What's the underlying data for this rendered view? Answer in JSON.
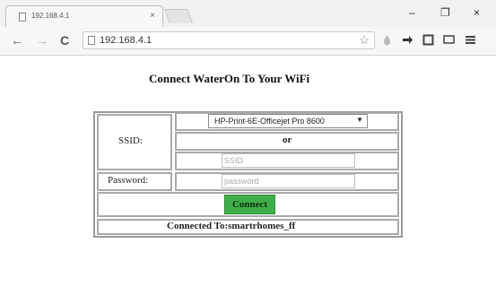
{
  "browser": {
    "tab_title": "192.168.4.1",
    "tab_close": "×",
    "url": "192.168.4.1",
    "window_controls": [
      "–",
      "❐",
      "×"
    ],
    "nav": {
      "back": "←",
      "forward": "→",
      "reload": "C"
    }
  },
  "page": {
    "heading": "Connect WaterOn To Your WiFi",
    "form": {
      "ssid_label": "SSID:",
      "ssid_selected": "HP-Print-6E-Officejet Pro 8600",
      "or_text": "or",
      "ssid_placeholder": "SSID",
      "password_label": "Password:",
      "password_placeholder": "password",
      "connect_label": "Connect",
      "status": "Connected To:smartrhomes_ff"
    }
  },
  "colors": {
    "connect_button": "#3fae49",
    "table_border": "#a9a9a9"
  }
}
